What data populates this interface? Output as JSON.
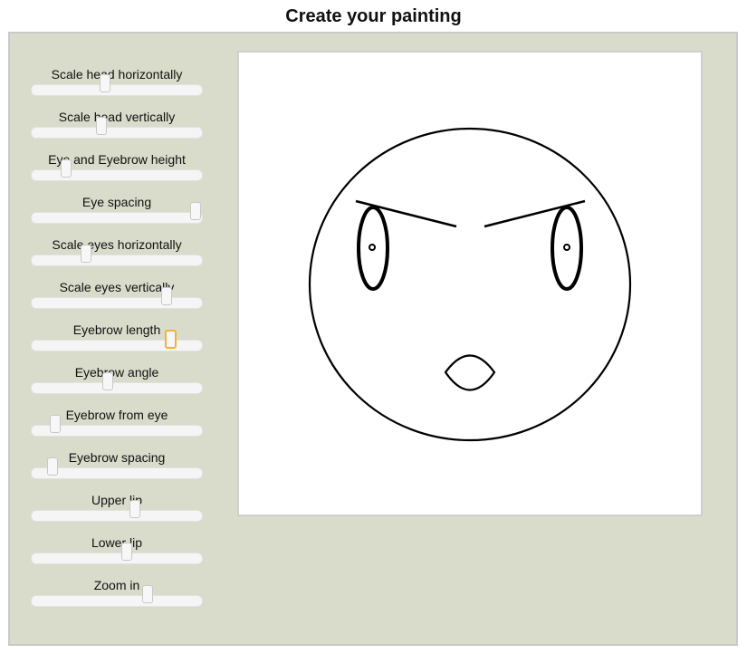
{
  "page": {
    "title": "Create your painting"
  },
  "sliders": [
    {
      "label": "Scale head horizontally",
      "value": 0.43
    },
    {
      "label": "Scale head vertically",
      "value": 0.41
    },
    {
      "label": "Eye and Eyebrow height",
      "value": 0.19
    },
    {
      "label": "Eye spacing",
      "value": 1.0
    },
    {
      "label": "Scale eyes horizontally",
      "value": 0.31
    },
    {
      "label": "Scale eyes vertically",
      "value": 0.82
    },
    {
      "label": "Eyebrow length",
      "value": 0.84,
      "focused": true
    },
    {
      "label": "Eyebrow angle",
      "value": 0.45
    },
    {
      "label": "Eyebrow from eye",
      "value": 0.12
    },
    {
      "label": "Eyebrow spacing",
      "value": 0.1
    },
    {
      "label": "Upper lip",
      "value": 0.62
    },
    {
      "label": "Lower lip",
      "value": 0.57
    },
    {
      "label": "Zoom in",
      "value": 0.7
    }
  ],
  "colors": {
    "panel": "#d9dbcb",
    "focus_ring": "#f0b23a",
    "stroke": "#000000"
  }
}
